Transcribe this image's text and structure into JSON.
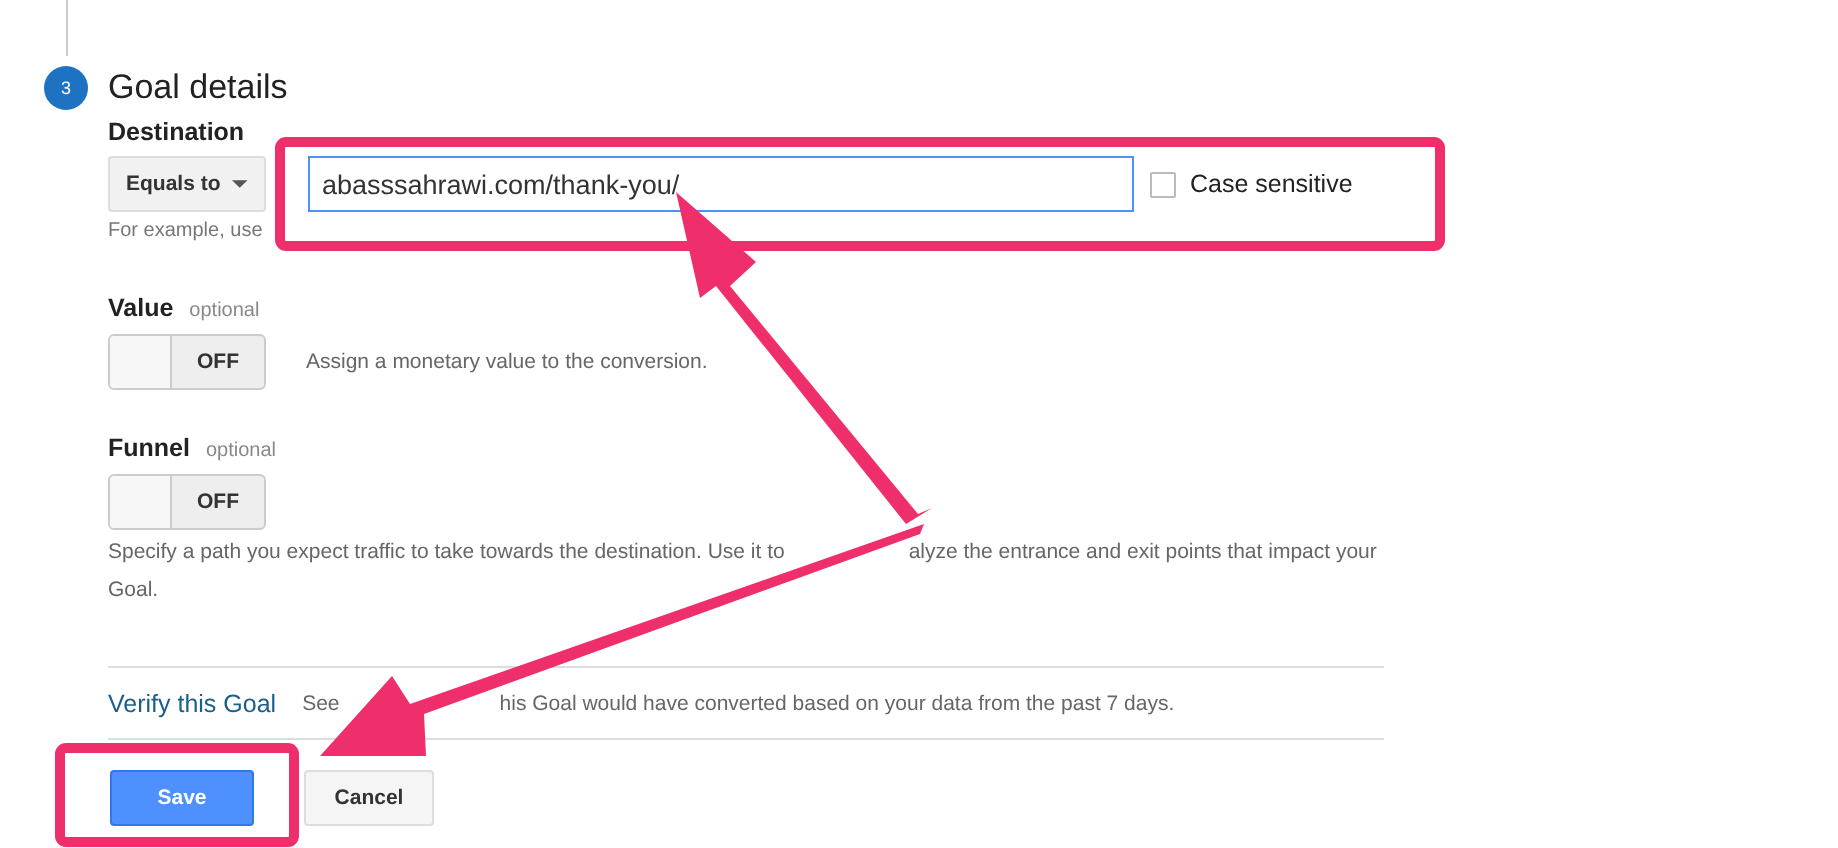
{
  "step": {
    "number": "3",
    "title": "Goal details"
  },
  "destination": {
    "label": "Destination",
    "match": "Equals to",
    "value": "abasssahrawi.com/thank-you/",
    "case_sensitive": {
      "label": "Case sensitive",
      "checked": false
    },
    "hint": "For example, use"
  },
  "toggles": [
    {
      "label": "Value",
      "note": "optional",
      "state": "OFF",
      "on": false,
      "description": [
        "Assign a monetary value to the conversion."
      ],
      "kind": "inline"
    },
    {
      "label": "Funnel",
      "note": "optional",
      "state": "OFF",
      "on": false,
      "description": [
        "Specify a path you expect traffic to take towards the destination. Use it to",
        "alyze the entrance and exit points that impact your",
        "Goal."
      ],
      "kind": "below"
    }
  ],
  "verify": {
    "link": "Verify this Goal",
    "text_start": "See",
    "text_end": "his Goal would have converted based on your data from the past 7 days."
  },
  "buttons": [
    {
      "label": "Save",
      "kind": "primary"
    },
    {
      "label": "Cancel",
      "kind": "secondary"
    }
  ]
}
